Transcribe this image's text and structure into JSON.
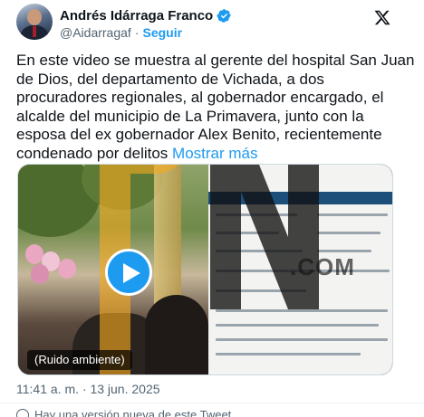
{
  "author": {
    "name": "Andrés Idárraga Franco",
    "handle": "@Aidarragaf",
    "separator": "·",
    "follow_label": "Seguir"
  },
  "post": {
    "text": "En este video se muestra al gerente del hospital San Juan de Dios, del departamento de Vichada, a dos procuradores regionales, al gobernador encargado, el alcalde del municipio de La Primavera, junto con la esposa del ex gobernador Alex Benito, recientemente condenado por delitos",
    "more_label": "Mostrar más",
    "timestamp": "11:41 a. m. · 13 jun. 2025"
  },
  "media": {
    "audio_label": "(Ruido ambiente)",
    "watermark_text": ".COM"
  },
  "footer": {
    "note": "Hay una versión nueva de este Tweet"
  },
  "icons": {
    "verified": "verified-badge-icon",
    "x_logo": "x-logo-icon",
    "play": "play-icon"
  },
  "colors": {
    "accent": "#1d9bf0",
    "text": "#0f1419",
    "muted": "#536471"
  }
}
